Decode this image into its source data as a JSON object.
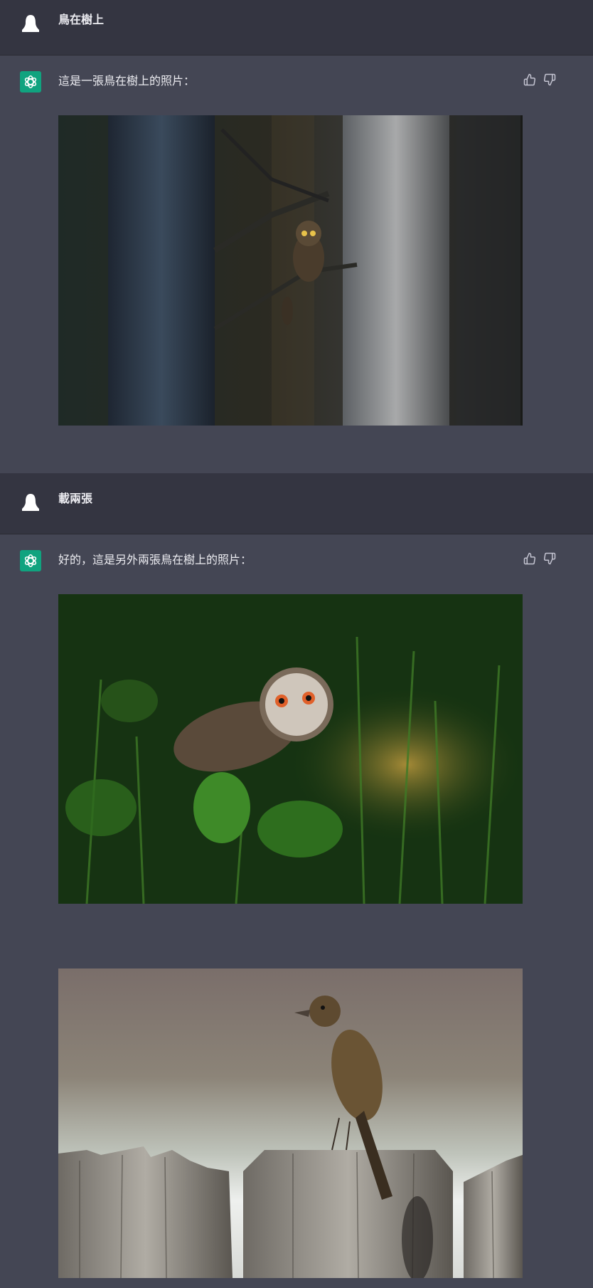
{
  "messages": [
    {
      "role": "user",
      "text": "鳥在樹上"
    },
    {
      "role": "assistant",
      "text": "這是一張鳥在樹上的照片："
    },
    {
      "role": "user",
      "text": "載兩張"
    },
    {
      "role": "assistant",
      "text": "好的，這是另外兩張鳥在樹上的照片："
    }
  ],
  "icons": {
    "user_avatar": "ghost-avatar-icon",
    "assistant_avatar": "openai-logo-icon",
    "thumbs_up": "thumbs-up-icon",
    "thumbs_down": "thumbs-down-icon"
  },
  "colors": {
    "user_bg": "#343541",
    "assistant_bg": "#444654",
    "assistant_avatar_bg": "#10a37f"
  }
}
